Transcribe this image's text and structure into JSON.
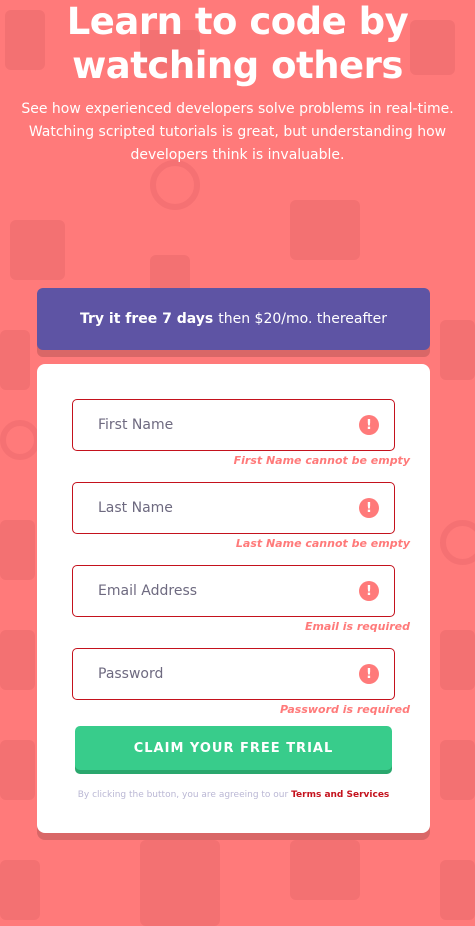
{
  "hero": {
    "title_line1": "Learn to code by",
    "title_line2": "watching others",
    "subtitle": "See how experienced developers solve problems in real-time. Watching scripted tutorials is great, but understanding how developers think is invaluable."
  },
  "promo": {
    "bold": "Try it free 7 days",
    "rest": "then $20/mo. thereafter"
  },
  "form": {
    "fields": [
      {
        "placeholder": "First Name",
        "error": "First Name cannot be empty"
      },
      {
        "placeholder": "Last Name",
        "error": "Last Name cannot be empty"
      },
      {
        "placeholder": "Email Address",
        "error": "Email is required"
      },
      {
        "placeholder": "Password",
        "error": "Password is required"
      }
    ],
    "error_icon": "!",
    "submit_label": "CLAIM YOUR FREE TRIAL",
    "terms_prefix": "By clicking the button, you are agreeing to our",
    "terms_link": "Terms and Services"
  },
  "colors": {
    "background": "#ff7a7a",
    "promo_bg": "#5e54a4",
    "accent_green": "#38cc8b",
    "error_red": "#ff7a7a",
    "error_border": "#c4121d"
  }
}
